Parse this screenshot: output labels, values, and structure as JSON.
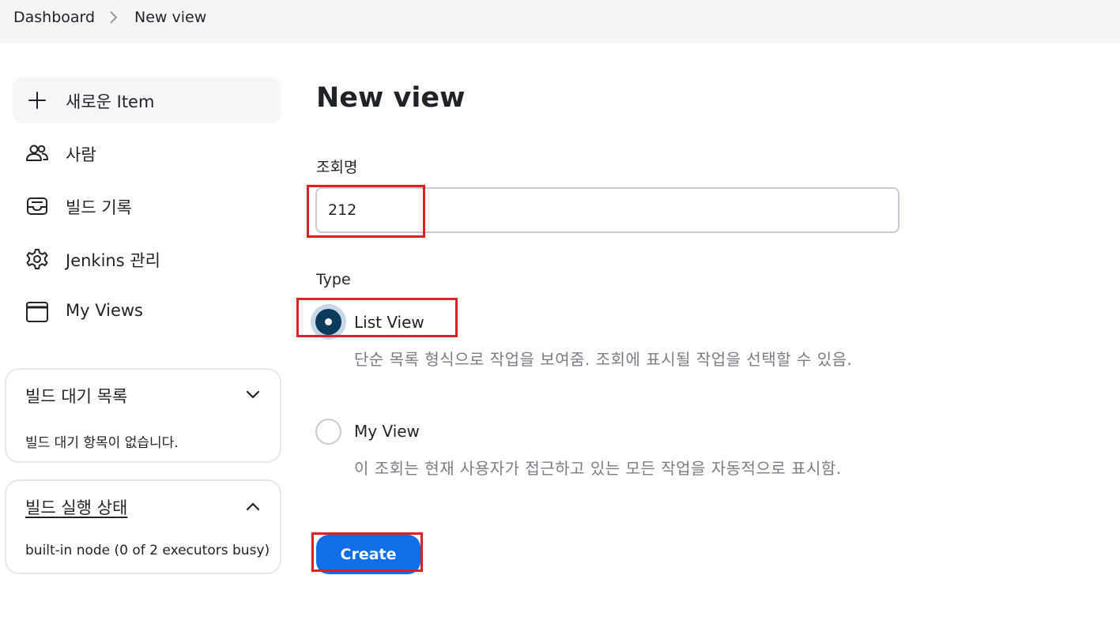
{
  "breadcrumb": {
    "items": [
      "Dashboard",
      "New view"
    ]
  },
  "sidebar": {
    "items": [
      {
        "label": "새로운 Item",
        "icon": "plus-icon"
      },
      {
        "label": "사람",
        "icon": "people-icon"
      },
      {
        "label": "빌드 기록",
        "icon": "inbox-icon"
      },
      {
        "label": "Jenkins 관리",
        "icon": "gear-icon"
      },
      {
        "label": "My Views",
        "icon": "window-icon"
      }
    ]
  },
  "build_queue": {
    "title": "빌드 대기 목록",
    "empty_text": "빌드 대기 항목이 없습니다."
  },
  "executor_status": {
    "title": "빌드 실행 상태",
    "node_text": "built-in node (0 of 2 executors busy)"
  },
  "main": {
    "title": "New view",
    "name_label": "조회명",
    "name_value": "212",
    "type_label": "Type",
    "options": [
      {
        "label": "List View",
        "description": "단순 목록 형식으로 작업을 보여줌. 조회에 표시될 작업을 선택할 수 있음.",
        "selected": true
      },
      {
        "label": "My View",
        "description": "이 조회는 현재 사용자가 접근하고 있는 모든 작업을 자동적으로 표시함.",
        "selected": false
      }
    ],
    "create_label": "Create"
  },
  "colors": {
    "accent": "#0f6ee8",
    "radio_selected": "#0b3a5b",
    "annotation": "#e02020"
  }
}
